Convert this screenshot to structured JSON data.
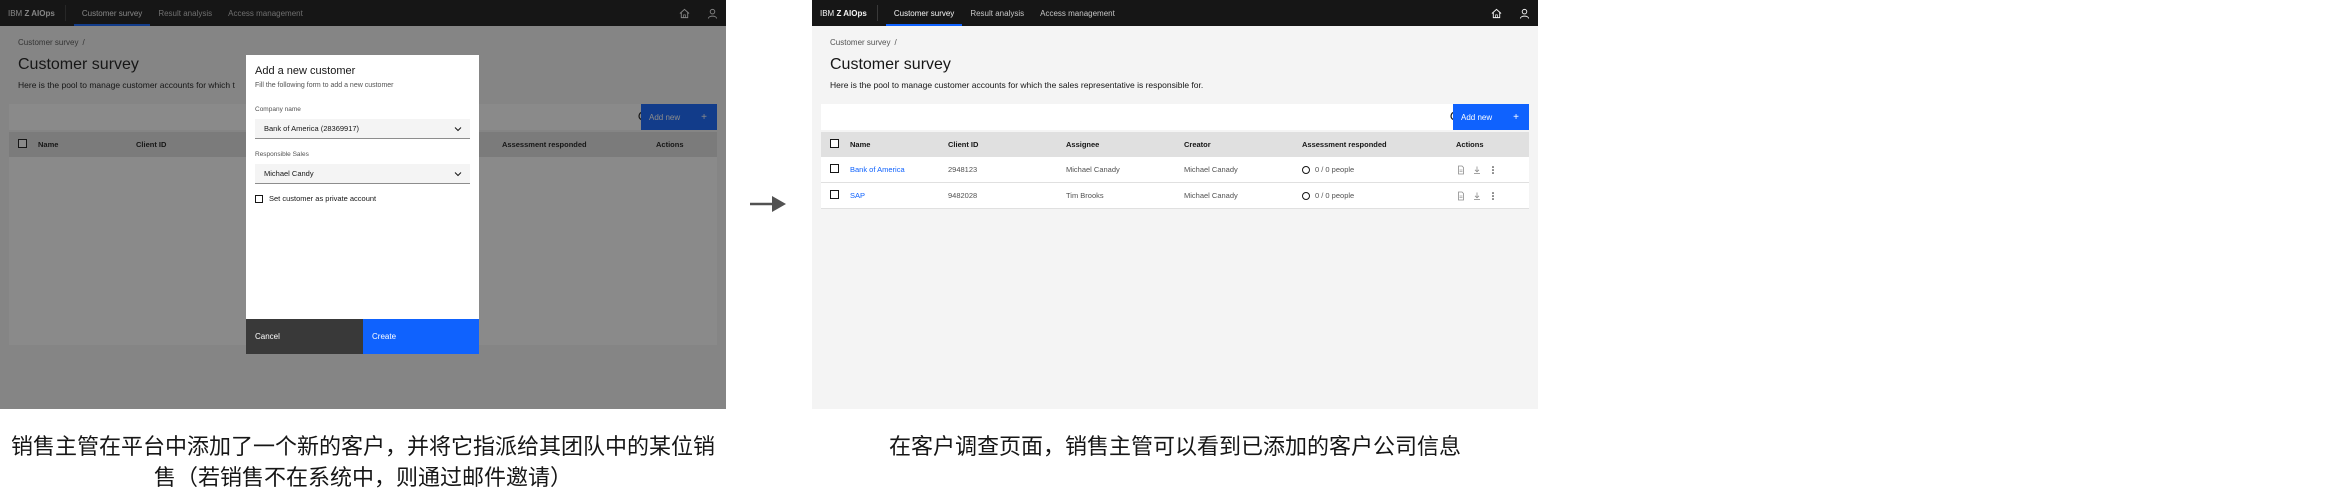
{
  "left_screen": {
    "header": {
      "brand_prefix": "IBM",
      "brand_name": "Z AIOps",
      "tabs": [
        {
          "label": "Customer survey",
          "active": true
        },
        {
          "label": "Result analysis",
          "active": false
        },
        {
          "label": "Access management",
          "active": false
        }
      ],
      "icons": [
        "home-icon",
        "user-icon"
      ]
    },
    "breadcrumb": "Customer survey",
    "title": "Customer survey",
    "description": "Here is the pool to manage customer accounts for which t",
    "add_button_label": "Add new",
    "table": {
      "headers": [
        "Name",
        "Client ID",
        "Assessment responded",
        "Actions"
      ]
    },
    "modal": {
      "title": "Add a new customer",
      "subtitle": "Fill the following form to add a new customer",
      "company_label": "Company name",
      "company_value": "Bank of America (28369917)",
      "sales_label": "Responsible Sales",
      "sales_value": "Michael Candy",
      "private_checkbox_label": "Set customer as private account",
      "cancel_label": "Cancel",
      "create_label": "Create"
    },
    "overlay_color": "#161616"
  },
  "right_screen": {
    "header": {
      "brand_prefix": "IBM",
      "brand_name": "Z AIOps",
      "tabs": [
        {
          "label": "Customer survey",
          "active": true
        },
        {
          "label": "Result analysis",
          "active": false
        },
        {
          "label": "Access management",
          "active": false
        }
      ],
      "icons": [
        "home-icon",
        "user-icon"
      ]
    },
    "breadcrumb": "Customer survey",
    "title": "Customer survey",
    "description": "Here is the pool to manage customer accounts for which the sales representative is responsible for.",
    "add_button_label": "Add new",
    "table": {
      "headers": [
        "Name",
        "Client ID",
        "Assignee",
        "Creator",
        "Assessment responded",
        "Actions"
      ],
      "rows": [
        {
          "name": "Bank of America",
          "client_id": "2948123",
          "assignee": "Michael Canady",
          "creator": "Michael Canady",
          "assessment": "0 / 0 people"
        },
        {
          "name": "SAP",
          "client_id": "9482028",
          "assignee": "Tim Brooks",
          "creator": "Michael Canady",
          "assessment": "0 / 0 people"
        }
      ]
    }
  },
  "captions": {
    "left": "销售主管在平台中添加了一个新的客户，并将它指派给其团队中的某位销售（若销售不在系统中，则通过邮件邀请）",
    "right": "在客户调查页面，销售主管可以看到已添加的客户公司信息"
  },
  "colors": {
    "topbar": "#161616",
    "accent": "#0f62fe",
    "page_background": "#f4f4f4",
    "table_header": "#e0e0e0",
    "link": "#0f62fe",
    "secondary_button": "#393939"
  }
}
